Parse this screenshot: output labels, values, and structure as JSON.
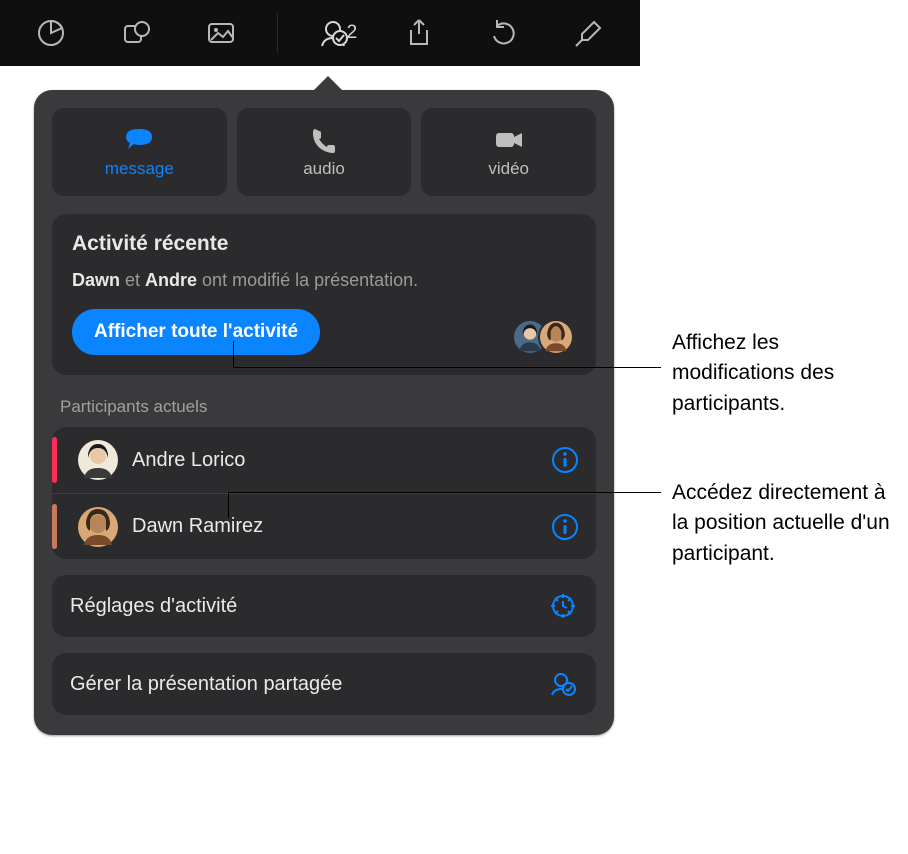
{
  "toolbar": {
    "collab_count": "2"
  },
  "comm": {
    "message": "message",
    "audio": "audio",
    "video": "vidéo"
  },
  "activity": {
    "title": "Activité récente",
    "name1": "Dawn",
    "connector": " et ",
    "name2": "Andre",
    "rest": " ont modifié la présentation.",
    "show_all": "Afficher toute l'activité"
  },
  "participants": {
    "heading": "Participants actuels",
    "items": [
      {
        "name": "Andre Lorico",
        "color": "#ff2d55"
      },
      {
        "name": "Dawn Ramirez",
        "color": "#c97a5a"
      }
    ]
  },
  "options": {
    "settings": "Réglages d'activité",
    "manage": "Gérer la présentation partagée"
  },
  "callouts": {
    "activityHint": "Affichez les modifications des participants.",
    "participantHint": "Accédez directement à la position actuelle d'un participant."
  }
}
